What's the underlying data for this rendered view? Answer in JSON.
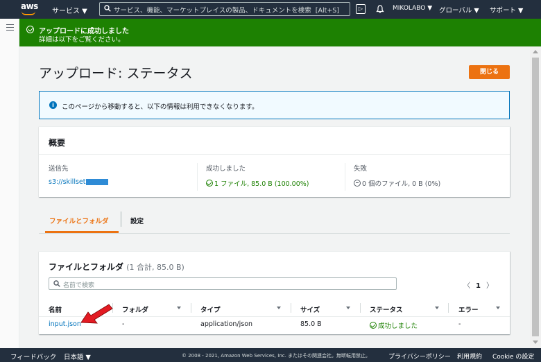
{
  "topnav": {
    "logo": "aws",
    "services": "サービス ▼",
    "search_placeholder": "サービス、機能、マーケットプレイスの製品、ドキュメントを検索",
    "search_shortcut": "[Alt+S]",
    "cloudshell_glyph": "▷",
    "user": "MIKOLABO ▼",
    "region": "グローバル ▼",
    "support": "サポート ▼"
  },
  "flash": {
    "title": "アップロードに成功しました",
    "message": "詳細は以下をご覧ください。",
    "color": "#1d8102"
  },
  "header": {
    "title": "アップロード: ステータス",
    "close_label": "閉じる",
    "accent": "#ec7211"
  },
  "info": {
    "icon": "i",
    "text": "このページから移動すると、以下の情報は利用できなくなります。"
  },
  "summary": {
    "heading": "概要",
    "destination_label": "送信先",
    "destination_value": "s3://skillset",
    "success_label": "成功しました",
    "success_value": "1 ファイル, 85.0 B (100.00%)",
    "failed_label": "失敗",
    "failed_value": "0 個のファイル, 0 B (0%)"
  },
  "tabs": {
    "files": "ファイルとフォルダ",
    "settings": "設定"
  },
  "files": {
    "heading": "ファイルとフォルダ",
    "count": "(1 合計, 85.0 B)",
    "search_placeholder": "名前で検索",
    "pager_prev": "〈",
    "page": "1",
    "pager_next": "〉",
    "columns": [
      "名前",
      "フォルダ",
      "タイプ",
      "サイズ",
      "ステータス",
      "エラー"
    ],
    "rows": [
      {
        "name": "input.json",
        "folder": "-",
        "type": "application/json",
        "size": "85.0 B",
        "status": "成功しました",
        "error": "-"
      }
    ]
  },
  "footer": {
    "feedback": "フィードバック",
    "language": "日本語 ▼",
    "copyright": "© 2008 - 2021, Amazon Web Services, Inc. またはその関連会社。無断転用禁止。",
    "privacy": "プライバシーポリシー",
    "terms": "利用規約",
    "cookie": "Cookie の設定"
  }
}
